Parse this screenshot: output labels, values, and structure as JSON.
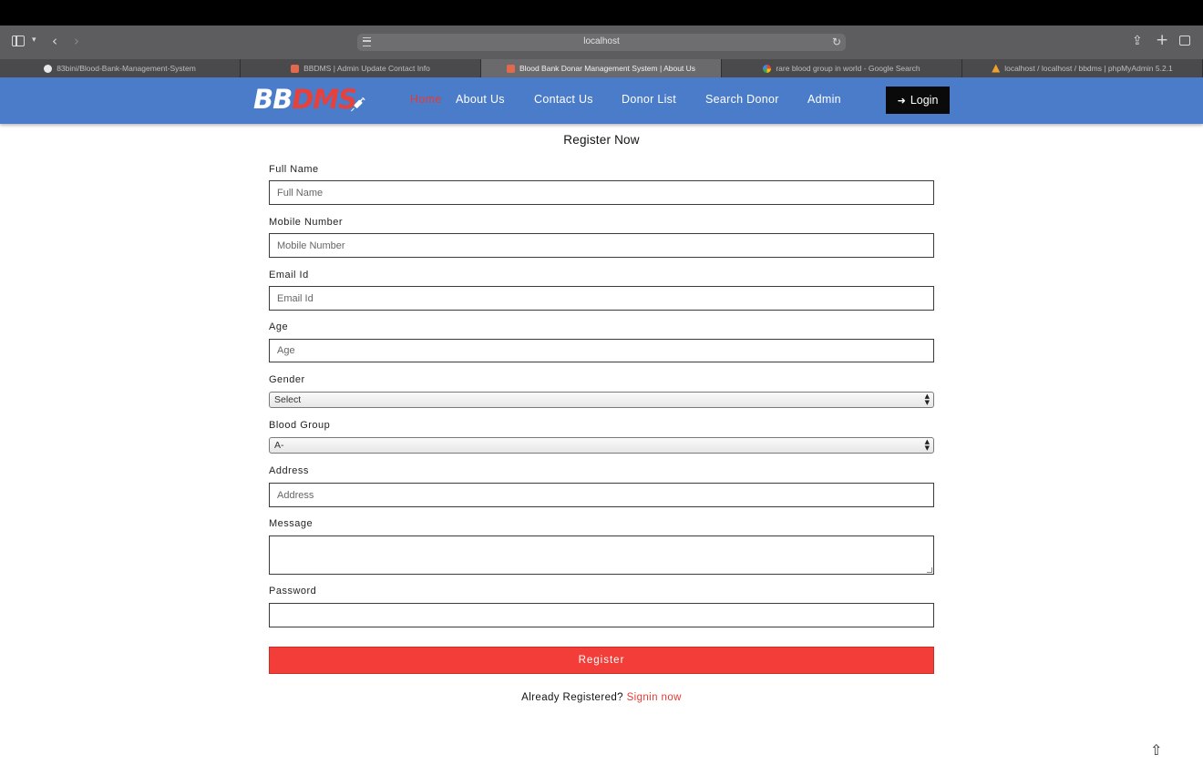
{
  "browser": {
    "address": "localhost",
    "tabs": [
      {
        "title": "83bini/Blood-Bank-Management-System",
        "icon": "github-icon",
        "active": false
      },
      {
        "title": "BBDMS | Admin Update Contact Info",
        "icon": "bbdms-favicon-icon",
        "active": false
      },
      {
        "title": "Blood Bank Donar Management System | About Us",
        "icon": "bbdms-favicon-icon",
        "active": true
      },
      {
        "title": "rare blood group in world - Google Search",
        "icon": "google-icon",
        "active": false
      },
      {
        "title": "localhost / localhost / bbdms | phpMyAdmin 5.2.1",
        "icon": "phpmyadmin-icon",
        "active": false
      }
    ]
  },
  "header": {
    "logo_part1": "BB",
    "logo_part2": "DMS",
    "nav": {
      "home": "Home",
      "about": "About Us",
      "contact": "Contact Us",
      "donor_list": "Donor List",
      "search_donor": "Search Donor",
      "admin": "Admin"
    },
    "login_label": "Login",
    "colors": {
      "header_bg": "#4a7cc9",
      "accent": "#e8403b",
      "login_bg": "#0a0a0a"
    }
  },
  "form": {
    "title": "Register Now",
    "full_name": {
      "label": "Full Name",
      "placeholder": "Full Name"
    },
    "mobile": {
      "label": "Mobile Number",
      "placeholder": "Mobile Number"
    },
    "email": {
      "label": "Email Id",
      "placeholder": "Email Id"
    },
    "age": {
      "label": "Age",
      "placeholder": "Age"
    },
    "gender": {
      "label": "Gender",
      "selected": "Select"
    },
    "blood_group": {
      "label": "Blood Group",
      "selected": "A-"
    },
    "address": {
      "label": "Address",
      "placeholder": "Address"
    },
    "message": {
      "label": "Message",
      "placeholder": ""
    },
    "password": {
      "label": "Password",
      "placeholder": ""
    },
    "register_label": "Register",
    "already_text": "Already Registered?",
    "signin_link": "Signin now",
    "colors": {
      "register_bg": "#f23d38",
      "link": "#e23b34"
    }
  }
}
